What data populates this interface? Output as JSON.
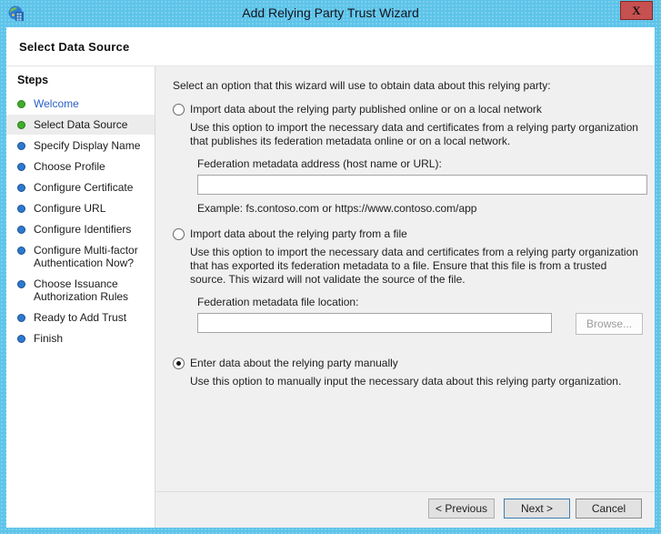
{
  "window": {
    "title": "Add Relying Party Trust Wizard",
    "close": "X"
  },
  "page": {
    "heading": "Select Data Source"
  },
  "steps": {
    "header": "Steps",
    "items": [
      {
        "label": "Welcome",
        "kind": "done-link"
      },
      {
        "label": "Select Data Source",
        "kind": "current"
      },
      {
        "label": "Specify Display Name",
        "kind": "upcoming"
      },
      {
        "label": "Choose Profile",
        "kind": "upcoming"
      },
      {
        "label": "Configure Certificate",
        "kind": "upcoming"
      },
      {
        "label": "Configure URL",
        "kind": "upcoming"
      },
      {
        "label": "Configure Identifiers",
        "kind": "upcoming"
      },
      {
        "label": "Configure Multi-factor Authentication Now?",
        "kind": "upcoming"
      },
      {
        "label": "Choose Issuance Authorization Rules",
        "kind": "upcoming"
      },
      {
        "label": "Ready to Add Trust",
        "kind": "upcoming"
      },
      {
        "label": "Finish",
        "kind": "upcoming"
      }
    ]
  },
  "main": {
    "intro": "Select an option that this wizard will use to obtain data about this relying party:",
    "options": [
      {
        "label": "Import data about the relying party published online or on a local network",
        "selected": false,
        "description": "Use this option to import the necessary data and certificates from a relying party organization that publishes its federation metadata online or on a local network.",
        "field_label": "Federation metadata address (host name or URL):",
        "field_value": "",
        "example": "Example: fs.contoso.com or https://www.contoso.com/app"
      },
      {
        "label": "Import data about the relying party from a file",
        "selected": false,
        "description": "Use this option to import the necessary data and certificates from a relying party organization that has exported its federation metadata to a file. Ensure that this file is from a trusted source.  This wizard will not validate the source of the file.",
        "field_label": "Federation metadata file location:",
        "field_value": "",
        "browse_label": "Browse..."
      },
      {
        "label": "Enter data about the relying party manually",
        "selected": true,
        "description": "Use this option to manually input the necessary data about this relying party organization."
      }
    ]
  },
  "footer": {
    "previous": "< Previous",
    "next": "Next >",
    "cancel": "Cancel"
  },
  "colors": {
    "titlebar": "#5dc4e9",
    "close_button": "#c75050",
    "step_done": "#3fae2a",
    "step_upcoming": "#2b7ad0",
    "link_step": "#2b5fc7",
    "next_button_border": "#3c7fb1",
    "content_background": "#f0f0f0"
  }
}
